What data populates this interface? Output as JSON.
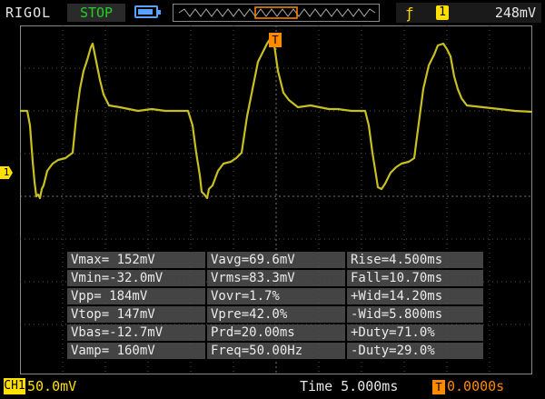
{
  "header": {
    "brand": "RIGOL",
    "run_state": "STOP",
    "trigger_channel": "1",
    "trigger_level": "248mV",
    "trigger_edge_icon": "rising-edge-icon",
    "battery_icon": "battery-icon"
  },
  "markers": {
    "trigger_position": "T",
    "channel1": "1"
  },
  "measurements": [
    [
      "Vmax= 152mV",
      "Vavg=69.6mV",
      "Rise=4.500ms"
    ],
    [
      "Vmin=-32.0mV",
      "Vrms=83.3mV",
      "Fall=10.70ms"
    ],
    [
      "Vpp= 184mV",
      "Vovr=1.7%",
      "+Wid=14.20ms"
    ],
    [
      "Vtop= 147mV",
      "Vpre=42.0%",
      "-Wid=5.800ms"
    ],
    [
      "Vbas=-12.7mV",
      "Prd=20.00ms",
      "+Duty=71.0%"
    ],
    [
      "Vamp= 160mV",
      "Freq=50.00Hz",
      "-Duty=29.0%"
    ]
  ],
  "footer": {
    "channel_label": "CH1",
    "channel_scale": "50.0mV",
    "timebase": "Time 5.000ms",
    "trigger_delay": "0.0000s",
    "trigger_delay_icon": "T"
  },
  "colors": {
    "trace": "#c8c020",
    "channel": "#ffe000",
    "trigger": "#ff8a00",
    "run_state": "#22d022"
  }
}
